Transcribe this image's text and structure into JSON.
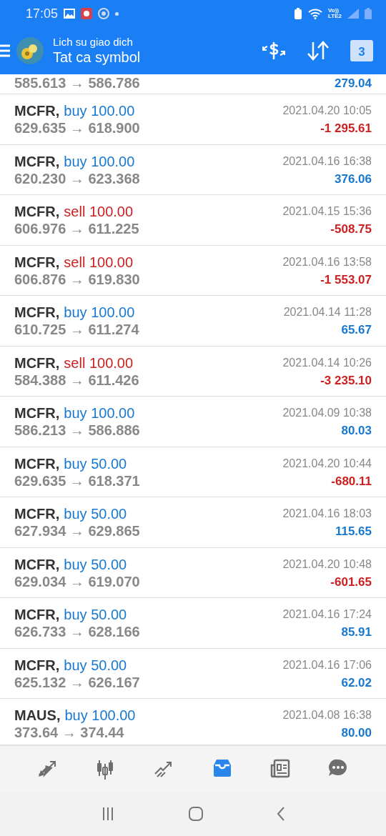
{
  "status_bar": {
    "time": "17:05",
    "network": [
      "Vo))",
      "LTE2"
    ]
  },
  "app_bar": {
    "title": "Lich su giao dich",
    "subtitle": "Tat ca symbol",
    "calendar_day": "3"
  },
  "partial_row": {
    "prices": "585.613 → 586.786",
    "profit": "279.04",
    "loss": false
  },
  "trades": [
    {
      "symbol": "MCFR,",
      "order": "buy 100.00",
      "kind": "buy",
      "prices": "629.635 → 618.900",
      "time": "2021.04.20 10:05",
      "profit": "-1 295.61",
      "loss": true
    },
    {
      "symbol": "MCFR,",
      "order": "buy 100.00",
      "kind": "buy",
      "prices": "620.230 → 623.368",
      "time": "2021.04.16 16:38",
      "profit": "376.06",
      "loss": false
    },
    {
      "symbol": "MCFR,",
      "order": "sell 100.00",
      "kind": "sell",
      "prices": "606.976 → 611.225",
      "time": "2021.04.15 15:36",
      "profit": "-508.75",
      "loss": true
    },
    {
      "symbol": "MCFR,",
      "order": "sell 100.00",
      "kind": "sell",
      "prices": "606.876 → 619.830",
      "time": "2021.04.16 13:58",
      "profit": "-1 553.07",
      "loss": true
    },
    {
      "symbol": "MCFR,",
      "order": "buy 100.00",
      "kind": "buy",
      "prices": "610.725 → 611.274",
      "time": "2021.04.14 11:28",
      "profit": "65.67",
      "loss": false
    },
    {
      "symbol": "MCFR,",
      "order": "sell 100.00",
      "kind": "sell",
      "prices": "584.388 → 611.426",
      "time": "2021.04.14 10:26",
      "profit": "-3 235.10",
      "loss": true
    },
    {
      "symbol": "MCFR,",
      "order": "buy 100.00",
      "kind": "buy",
      "prices": "586.213 → 586.886",
      "time": "2021.04.09 10:38",
      "profit": "80.03",
      "loss": false
    },
    {
      "symbol": "MCFR,",
      "order": "buy 50.00",
      "kind": "buy",
      "prices": "629.635 → 618.371",
      "time": "2021.04.20 10:44",
      "profit": "-680.11",
      "loss": true
    },
    {
      "symbol": "MCFR,",
      "order": "buy 50.00",
      "kind": "buy",
      "prices": "627.934 → 629.865",
      "time": "2021.04.16 18:03",
      "profit": "115.65",
      "loss": false
    },
    {
      "symbol": "MCFR,",
      "order": "buy 50.00",
      "kind": "buy",
      "prices": "629.034 → 619.070",
      "time": "2021.04.20 10:48",
      "profit": "-601.65",
      "loss": true
    },
    {
      "symbol": "MCFR,",
      "order": "buy 50.00",
      "kind": "buy",
      "prices": "626.733 → 628.166",
      "time": "2021.04.16 17:24",
      "profit": "85.91",
      "loss": false
    },
    {
      "symbol": "MCFR,",
      "order": "buy 50.00",
      "kind": "buy",
      "prices": "625.132 → 626.167",
      "time": "2021.04.16 17:06",
      "profit": "62.02",
      "loss": false
    },
    {
      "symbol": "MAUS,",
      "order": "buy 100.00",
      "kind": "buy",
      "prices": "373.64 → 374.44",
      "time": "2021.04.08 16:38",
      "profit": "80.00",
      "loss": false
    }
  ],
  "bottom_nav": [
    {
      "kind": "quotes",
      "selected": false
    },
    {
      "kind": "chart",
      "selected": false
    },
    {
      "kind": "trade",
      "selected": false
    },
    {
      "kind": "history",
      "selected": true
    },
    {
      "kind": "news",
      "selected": false
    },
    {
      "kind": "chat",
      "selected": false
    }
  ]
}
